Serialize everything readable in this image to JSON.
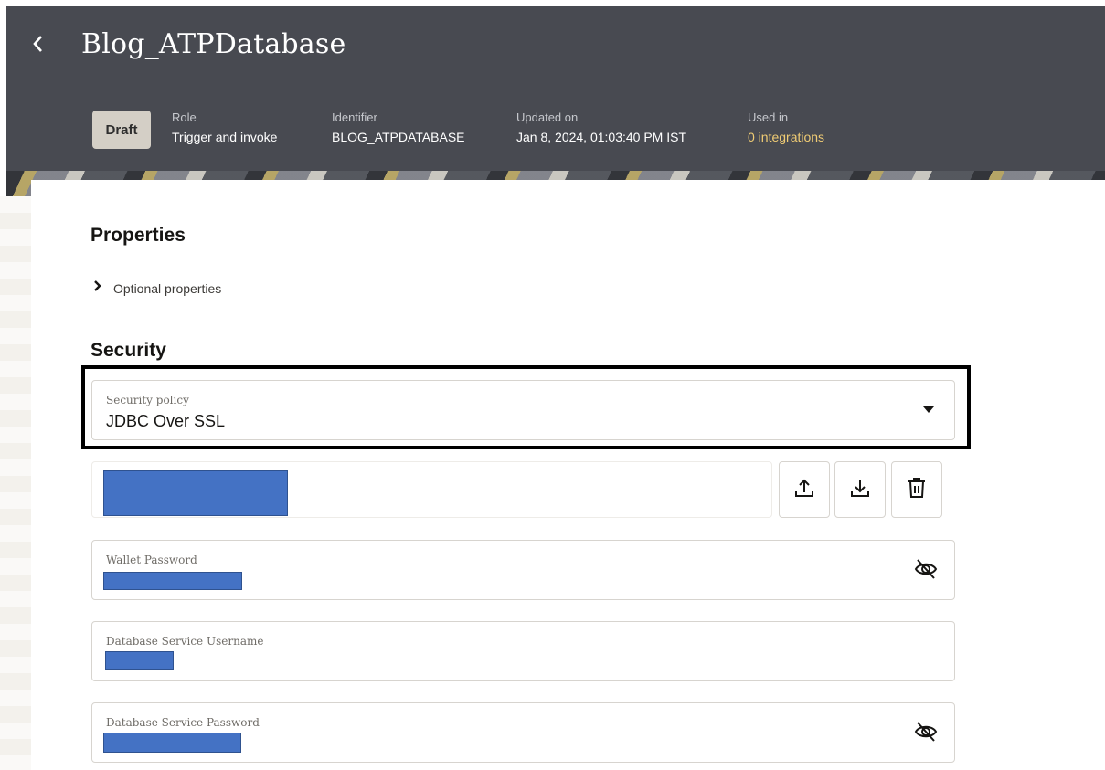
{
  "header": {
    "title": "Blog_ATPDatabase",
    "status": "Draft",
    "meta": [
      {
        "label": "Role",
        "value": "Trigger and invoke"
      },
      {
        "label": "Identifier",
        "value": "BLOG_ATPDATABASE"
      },
      {
        "label": "Updated on",
        "value": "Jan 8, 2024, 01:03:40 PM IST"
      },
      {
        "label": "Used in",
        "value": "0 integrations"
      }
    ]
  },
  "properties": {
    "title": "Properties",
    "optional_label": "Optional properties"
  },
  "security": {
    "title": "Security",
    "policy_label": "Security policy",
    "policy_value": "JDBC Over SSL",
    "wallet_password_label": "Wallet Password",
    "db_username_label": "Database Service Username",
    "db_password_label": "Database Service Password"
  },
  "icons": {
    "back": "chevron-left-icon",
    "disclosure": "chevron-right-icon",
    "dropdown": "caret-down-icon",
    "upload": "upload-icon",
    "download": "download-icon",
    "delete": "trash-icon",
    "hide_password": "eye-slash-icon"
  },
  "colors": {
    "header_bg": "#484a51",
    "badge_bg": "#d4cfc6",
    "link": "#f0cc74",
    "redaction": "#4472c4",
    "highlight_border": "#000000"
  }
}
